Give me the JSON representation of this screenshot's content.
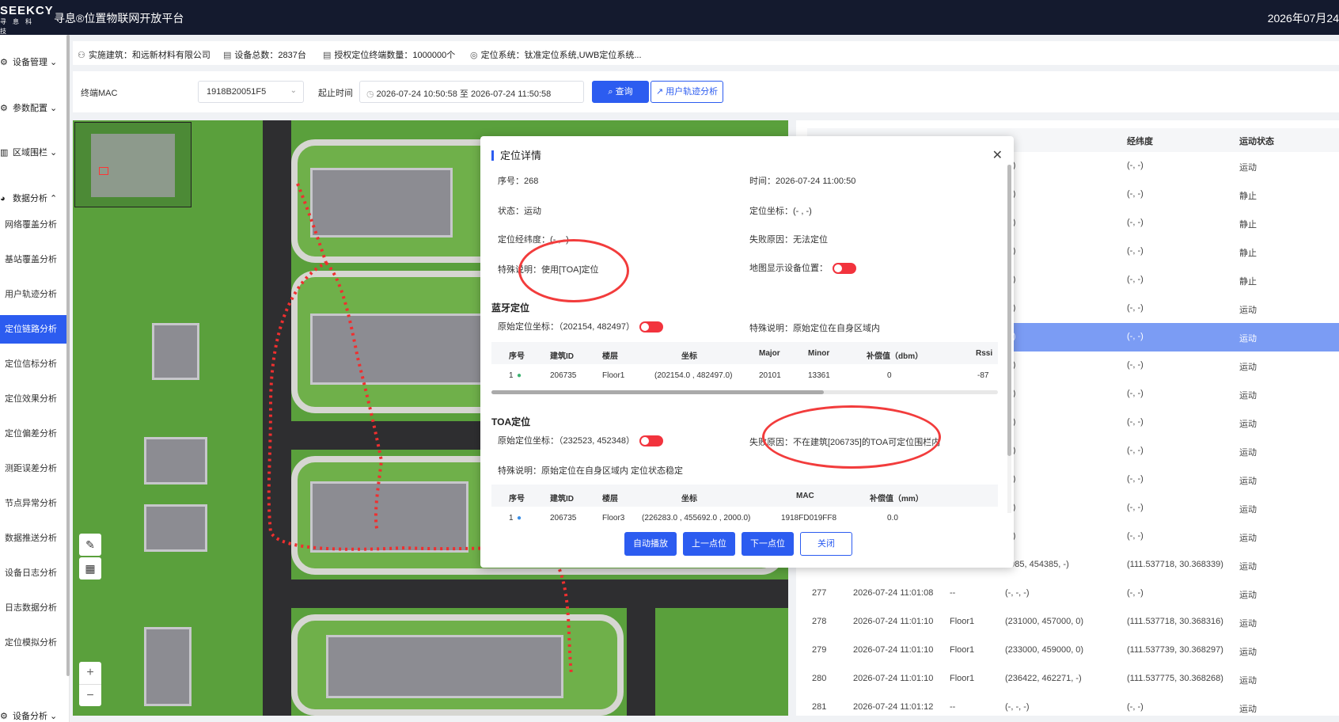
{
  "header": {
    "brand": "SEEKCY",
    "brand_sub": "寻息科技",
    "title": "寻息®位置物联网开放平台",
    "date": "2026年07月24"
  },
  "sidebar": {
    "groups": [
      {
        "icon": "gear-icon",
        "label": "设备管理 ⌄"
      },
      {
        "icon": "params-icon",
        "label": "参数配置 ⌄"
      },
      {
        "icon": "fence-icon",
        "label": "区域围栏 ⌄"
      },
      {
        "icon": "pie-icon",
        "label": "数据分析 ⌃"
      },
      {
        "icon": "gear-icon",
        "label": "设备分析 ⌄"
      }
    ],
    "items": [
      "网络覆盖分析",
      "基站覆盖分析",
      "用户轨迹分析",
      "定位链路分析",
      "定位信标分析",
      "定位效果分析",
      "定位偏差分析",
      "测距误差分析",
      "节点异常分析",
      "数据推送分析",
      "设备日志分析",
      "日志数据分析",
      "定位模拟分析"
    ]
  },
  "info": {
    "building": "实施建筑：和远新材料有限公司",
    "device_total": "设备总数：2837台",
    "license": "授权定位终端数量：1000000个",
    "system": "定位系统：钛准定位系统,UWB定位系统..."
  },
  "filter": {
    "mac_label": "终端MAC",
    "mac_value": "1918B20051F5",
    "time_label": "起止时间",
    "time_start": "2026-07-24 10:50:58",
    "time_sep": "至",
    "time_end": "2026-07-24 11:50:58",
    "query": "查询",
    "track": "用户轨迹分析"
  },
  "map": {
    "tool_ruler": "✎",
    "tool_grid": "▦",
    "zoom_in": "+",
    "zoom_out": "−"
  },
  "table": {
    "headers": [
      "经纬度",
      "运动状态"
    ],
    "partial_rows": [
      {
        "coord": ", -)",
        "lnglat": "(-, -)",
        "state": "运动"
      },
      {
        "coord": ", -)",
        "lnglat": "(-, -)",
        "state": "静止"
      },
      {
        "coord": ", -)",
        "lnglat": "(-, -)",
        "state": "静止"
      },
      {
        "coord": ", -)",
        "lnglat": "(-, -)",
        "state": "静止"
      },
      {
        "coord": ", -)",
        "lnglat": "(-, -)",
        "state": "静止"
      },
      {
        "coord": ", -)",
        "lnglat": "(-, -)",
        "state": "运动"
      },
      {
        "coord": ", -)",
        "lnglat": "(-, -)",
        "state": "运动"
      },
      {
        "coord": ", -)",
        "lnglat": "(-, -)",
        "state": "运动"
      },
      {
        "coord": ", -)",
        "lnglat": "(-, -)",
        "state": "运动"
      },
      {
        "coord": ", -)",
        "lnglat": "(-, -)",
        "state": "运动"
      },
      {
        "coord": ", -)",
        "lnglat": "(-, -)",
        "state": "运动"
      },
      {
        "coord": ", -)",
        "lnglat": "(-, -)",
        "state": "运动"
      },
      {
        "coord": ", -)",
        "lnglat": "(-, -)",
        "state": "运动"
      },
      {
        "coord": ", -)",
        "lnglat": "(-, -)",
        "state": "运动"
      },
      {
        "coord": "0985, 454385, -)",
        "lnglat": "(111.537718, 30.368339)",
        "state": "运动"
      }
    ],
    "rows": [
      {
        "no": "277",
        "time": "2026-07-24 11:01:08",
        "floor": "--",
        "coord": "(-, -, -)",
        "lnglat": "(-, -)",
        "state": "运动"
      },
      {
        "no": "278",
        "time": "2026-07-24 11:01:10",
        "floor": "Floor1",
        "coord": "(231000, 457000, 0)",
        "lnglat": "(111.537718, 30.368316)",
        "state": "运动"
      },
      {
        "no": "279",
        "time": "2026-07-24 11:01:10",
        "floor": "Floor1",
        "coord": "(233000, 459000, 0)",
        "lnglat": "(111.537739, 30.368297)",
        "state": "运动"
      },
      {
        "no": "280",
        "time": "2026-07-24 11:01:10",
        "floor": "Floor1",
        "coord": "(236422, 462271, -)",
        "lnglat": "(111.537775, 30.368268)",
        "state": "运动"
      },
      {
        "no": "281",
        "time": "2026-07-24 11:01:12",
        "floor": "--",
        "coord": "(-, -, -)",
        "lnglat": "(-, -)",
        "state": "运动"
      }
    ]
  },
  "modal": {
    "title": "定位详情",
    "seq": "序号：268",
    "time": "时间：2026-07-24 11:00:50",
    "state": "状态：运动",
    "coord": "定位坐标：(- , -)",
    "lnglat": "定位经纬度：(- , -)",
    "fail": "失败原因：无法定位",
    "special": "特殊说明：使用[TOA]定位",
    "map_show": "地图显示设备位置：",
    "bt_title": "蓝牙定位",
    "bt_raw": "原始定位坐标：（202154, 482497）",
    "bt_note": "特殊说明：原始定位在自身区域内",
    "bt_headers": [
      "序号",
      "建筑ID",
      "楼层",
      "坐标",
      "Major",
      "Minor",
      "补偿值（dbm）",
      "Rssi"
    ],
    "bt_row": [
      "1",
      "206735",
      "Floor1",
      "(202154.0 , 482497.0)",
      "20101",
      "13361",
      "0",
      "-87"
    ],
    "toa_title": "TOA定位",
    "toa_raw": "原始定位坐标：（232523, 452348）",
    "toa_fail": "失败原因：不在建筑[206735]的TOA可定位围栏内",
    "toa_note": "特殊说明：原始定位在自身区域内 定位状态稳定",
    "toa_headers": [
      "序号",
      "建筑ID",
      "楼层",
      "坐标",
      "MAC",
      "补偿值（mm）"
    ],
    "toa_row": [
      "1",
      "206735",
      "Floor3",
      "(226283.0 , 455692.0 , 2000.0)",
      "1918FD019FF8",
      "0.0"
    ],
    "buttons": [
      "自动播放",
      "上一点位",
      "下一点位",
      "关闭"
    ]
  },
  "colors": {
    "accent": "#2c5cf0",
    "header_bg": "#141a2e",
    "toggle": "#f2333d",
    "selected_row": "#7b9cf4",
    "annotation": "#f23c3c"
  }
}
